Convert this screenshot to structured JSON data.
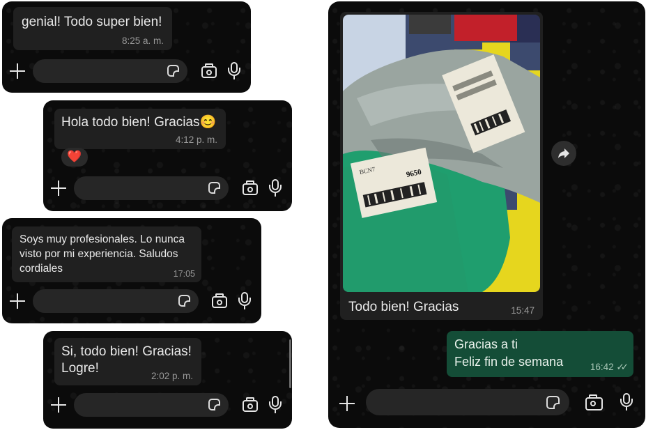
{
  "panel1": {
    "message": "genial! Todo super bien!",
    "time": "8:25 a. m."
  },
  "panel2": {
    "message": "Hola todo bien! Gracias😊",
    "time": "4:12 p. m.",
    "reaction": "❤️"
  },
  "panel3": {
    "message": "Soys muy profesionales. Lo nunca\nvisto por mi experiencia. Saludos\ncordiales",
    "time": "17:05"
  },
  "panel4": {
    "message": "Si, todo bien! Gracias!\nLogre!",
    "time": "2:02 p. m."
  },
  "panel5": {
    "photo_caption": "Todo bien! Gracias",
    "photo_time": "15:47",
    "forward_icon": "forward-arrow",
    "label_text_1": "BCN7",
    "label_text_2": "9650",
    "outgoing_line1": "Gracias a ti",
    "outgoing_line2": "Feliz fin de semana",
    "outgoing_time": "16:42",
    "read_receipt": "✓✓"
  },
  "icons": [
    "plus-icon",
    "sticker-icon",
    "camera-icon",
    "microphone-icon"
  ],
  "colors": {
    "background": "#0b0b0b",
    "incoming_bubble": "#202020",
    "outgoing_bubble": "#144d37",
    "input_field": "#262626"
  }
}
